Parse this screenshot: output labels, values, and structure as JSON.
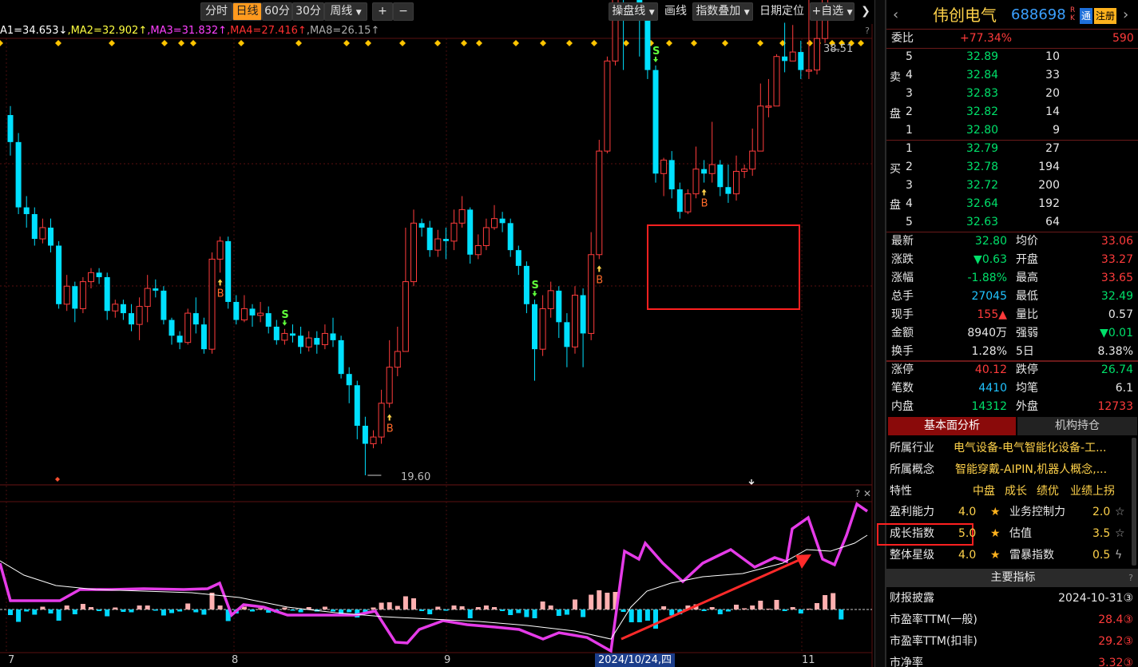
{
  "toolbar": {
    "period_tabs": [
      "分时",
      "日线",
      "60分",
      "30分",
      "周线"
    ],
    "active_period": "日线",
    "zoom_in": "+",
    "zoom_out": "−",
    "tools": [
      "操盘线",
      "画线",
      "指数叠加",
      "日期定位",
      "+自选"
    ],
    "collapse_icon": "double-chevron-right-icon"
  },
  "ma_legend": [
    {
      "text": "A1=34.653↓",
      "color": "#ffffff"
    },
    {
      "text": ",MA2=32.902↑",
      "color": "#ffff40"
    },
    {
      "text": ",MA3=31.832↑",
      "color": "#ff40ff"
    },
    {
      "text": ",MA4=27.416↑",
      "color": "#ff3030"
    },
    {
      "text": ",MA8=26.15↑",
      "color": "#aaaaaa"
    }
  ],
  "chart_data": {
    "type": "candlestick",
    "high_label": "38.51",
    "low_label": "19.60",
    "signal_buy": "B",
    "signal_sell": "S",
    "x_month_labels": [
      "7",
      "8",
      "9",
      "10",
      "11"
    ],
    "current_date": "2024/10/24,四",
    "candles": [
      [
        35.6,
        34.4,
        36.0,
        33.8
      ],
      [
        34.4,
        31.5,
        34.8,
        31.2
      ],
      [
        31.5,
        31.2,
        32.0,
        30.6
      ],
      [
        31.2,
        30.1,
        31.5,
        29.8
      ],
      [
        30.1,
        30.6,
        31.0,
        29.9
      ],
      [
        30.6,
        29.8,
        31.0,
        29.5
      ],
      [
        29.8,
        27.2,
        30.0,
        27.0
      ],
      [
        27.2,
        28.0,
        28.5,
        26.9
      ],
      [
        28.0,
        27.0,
        28.2,
        26.4
      ],
      [
        27.0,
        28.2,
        28.4,
        26.8
      ],
      [
        28.2,
        28.6,
        28.8,
        27.9
      ],
      [
        28.6,
        28.4,
        28.8,
        28.1
      ],
      [
        28.4,
        26.9,
        28.6,
        26.5
      ],
      [
        26.9,
        27.2,
        27.4,
        26.6
      ],
      [
        27.2,
        26.8,
        27.4,
        26.5
      ],
      [
        26.8,
        26.3,
        27.2,
        26.0
      ],
      [
        26.3,
        27.1,
        27.5,
        25.6
      ],
      [
        27.1,
        27.9,
        28.5,
        26.4
      ],
      [
        27.9,
        27.8,
        28.3,
        27.5
      ],
      [
        27.8,
        26.5,
        28.0,
        26.3
      ],
      [
        26.5,
        25.8,
        26.6,
        25.4
      ],
      [
        25.8,
        25.5,
        26.0,
        25.2
      ],
      [
        25.5,
        26.8,
        27.0,
        25.4
      ],
      [
        26.8,
        26.3,
        27.5,
        25.9
      ],
      [
        26.3,
        25.2,
        26.6,
        25.0
      ],
      [
        25.2,
        29.2,
        29.5,
        25.0
      ],
      [
        29.2,
        30.0,
        30.2,
        28.6
      ],
      [
        30.0,
        27.3,
        30.2,
        27.0
      ],
      [
        27.3,
        26.5,
        27.6,
        26.3
      ],
      [
        26.5,
        27.0,
        27.6,
        26.4
      ],
      [
        27.0,
        26.7,
        27.2,
        26.2
      ],
      [
        26.7,
        26.8,
        27.3,
        26.4
      ],
      [
        26.8,
        26.2,
        27.1,
        25.9
      ],
      [
        26.2,
        25.6,
        26.5,
        25.4
      ],
      [
        25.6,
        25.9,
        26.1,
        25.4
      ],
      [
        25.9,
        25.8,
        26.3,
        25.5
      ],
      [
        25.8,
        25.3,
        26.2,
        25.0
      ],
      [
        25.3,
        25.7,
        26.0,
        25.1
      ],
      [
        25.7,
        25.4,
        26.0,
        25.0
      ],
      [
        25.4,
        25.9,
        26.3,
        25.2
      ],
      [
        25.9,
        25.6,
        26.6,
        25.3
      ],
      [
        25.6,
        24.1,
        25.8,
        23.9
      ],
      [
        24.1,
        23.6,
        24.4,
        22.8
      ],
      [
        23.6,
        21.8,
        23.8,
        21.2
      ],
      [
        21.8,
        21.0,
        22.2,
        19.6
      ],
      [
        21.0,
        21.3,
        21.6,
        20.8
      ],
      [
        21.3,
        22.8,
        23.4,
        21.0
      ],
      [
        22.8,
        24.4,
        25.6,
        22.6
      ],
      [
        24.4,
        25.1,
        26.2,
        24.0
      ],
      [
        25.1,
        28.2,
        30.6,
        25.1
      ],
      [
        28.2,
        30.8,
        31.4,
        28.0
      ],
      [
        30.8,
        30.6,
        31.0,
        30.2
      ],
      [
        30.6,
        29.6,
        30.9,
        29.3
      ],
      [
        29.6,
        30.1,
        30.5,
        29.3
      ],
      [
        30.1,
        30.0,
        30.6,
        29.2
      ],
      [
        30.0,
        30.8,
        31.4,
        29.6
      ],
      [
        30.8,
        31.4,
        32.0,
        30.6
      ],
      [
        31.4,
        29.4,
        31.5,
        29.0
      ],
      [
        29.4,
        29.8,
        30.3,
        29.2
      ],
      [
        29.8,
        30.6,
        31.0,
        29.6
      ],
      [
        30.6,
        31.0,
        31.6,
        30.5
      ],
      [
        31.0,
        30.8,
        31.3,
        30.4
      ],
      [
        30.8,
        29.6,
        31.0,
        29.3
      ],
      [
        29.6,
        28.9,
        29.8,
        28.5
      ],
      [
        28.9,
        27.2,
        29.1,
        26.8
      ],
      [
        27.2,
        25.2,
        27.4,
        23.8
      ],
      [
        25.2,
        27.0,
        27.6,
        24.9
      ],
      [
        27.0,
        27.8,
        28.2,
        26.6
      ],
      [
        27.8,
        26.4,
        28.0,
        25.7
      ],
      [
        26.4,
        25.3,
        26.8,
        24.4
      ],
      [
        25.3,
        27.6,
        28.0,
        25.0
      ],
      [
        27.6,
        25.9,
        27.9,
        24.4
      ],
      [
        25.9,
        29.4,
        30.4,
        25.6
      ],
      [
        29.4,
        34.0,
        34.5,
        29.2
      ],
      [
        34.0,
        38.0,
        38.2,
        33.9
      ],
      [
        38.0,
        42.2,
        43.5,
        37.8
      ],
      [
        43.1,
        42.7,
        46.2,
        37.6
      ],
      [
        46.0,
        43.0,
        47.0,
        42.0
      ],
      [
        43.0,
        40.0,
        43.5,
        38.2
      ],
      [
        40.2,
        37.6,
        40.4,
        37.2
      ],
      [
        37.6,
        33.0,
        37.8,
        32.6
      ],
      [
        33.0,
        33.6,
        33.7,
        32.0
      ],
      [
        33.6,
        32.3,
        34.0,
        31.9
      ],
      [
        32.3,
        31.3,
        32.6,
        31.0
      ],
      [
        31.3,
        32.1,
        32.3,
        31.2
      ],
      [
        32.1,
        33.2,
        34.2,
        31.9
      ],
      [
        33.2,
        33.0,
        33.6,
        32.6
      ],
      [
        33.0,
        33.4,
        35.3,
        32.6
      ],
      [
        33.4,
        32.4,
        33.6,
        32.0
      ],
      [
        32.4,
        32.1,
        33.4,
        31.7
      ],
      [
        32.1,
        33.1,
        33.8,
        31.8
      ],
      [
        33.1,
        33.2,
        33.4,
        32.8
      ],
      [
        33.2,
        34.0,
        35.0,
        32.9
      ],
      [
        34.0,
        36.0,
        37.0,
        34.0
      ],
      [
        36.0,
        36.0,
        37.2,
        35.5
      ],
      [
        36.0,
        38.2,
        38.3,
        36.5
      ],
      [
        38.2,
        38.0,
        39.7,
        37.5
      ],
      [
        38.0,
        38.4,
        39.6,
        38.1
      ],
      [
        38.4,
        37.6,
        38.9,
        37.2
      ],
      [
        37.6,
        37.6,
        40.8,
        37.2
      ],
      [
        37.6,
        39.0,
        40.3,
        37.4
      ],
      [
        39.0,
        42.4,
        42.8,
        38.8
      ],
      [
        42.4,
        46.3,
        46.5,
        42.0
      ],
      [
        46.3,
        44.0,
        48.5,
        43.8
      ]
    ]
  },
  "quote": {
    "name": "伟创电气",
    "code": "688698",
    "badge_rk": "R K",
    "badge_tong": "通",
    "badge_zc": "注册",
    "weibi_label": "委比",
    "weibi_value": "+77.34%",
    "weibi_diff": "590",
    "sell_label": [
      "卖",
      "盘"
    ],
    "buy_label": [
      "买",
      "盘"
    ],
    "asks": [
      {
        "lvl": "5",
        "price": "32.89",
        "vol": "10"
      },
      {
        "lvl": "4",
        "price": "32.84",
        "vol": "33"
      },
      {
        "lvl": "3",
        "price": "32.83",
        "vol": "20"
      },
      {
        "lvl": "2",
        "price": "32.82",
        "vol": "14"
      },
      {
        "lvl": "1",
        "price": "32.80",
        "vol": "9"
      }
    ],
    "bids": [
      {
        "lvl": "1",
        "price": "32.79",
        "vol": "27"
      },
      {
        "lvl": "2",
        "price": "32.78",
        "vol": "194"
      },
      {
        "lvl": "3",
        "price": "32.72",
        "vol": "200"
      },
      {
        "lvl": "4",
        "price": "32.64",
        "vol": "192"
      },
      {
        "lvl": "5",
        "price": "32.63",
        "vol": "64"
      }
    ],
    "stats": [
      {
        "l1": "最新",
        "v1": "32.80",
        "c1": "grn",
        "l2": "均价",
        "v2": "33.06",
        "c2": "red"
      },
      {
        "l1": "涨跌",
        "v1": "▼0.63",
        "c1": "grn",
        "l2": "开盘",
        "v2": "33.27",
        "c2": "red"
      },
      {
        "l1": "涨幅",
        "v1": "-1.88%",
        "c1": "grn",
        "l2": "最高",
        "v2": "33.65",
        "c2": "red"
      },
      {
        "l1": "总手",
        "v1": "27045",
        "c1": "cy",
        "l2": "最低",
        "v2": "32.49",
        "c2": "grn"
      },
      {
        "l1": "现手",
        "v1": "155▲",
        "c1": "red",
        "l2": "量比",
        "v2": "0.57",
        "c2": "wht"
      },
      {
        "l1": "金额",
        "v1": "8940万",
        "c1": "wht",
        "l2": "强弱",
        "v2": "▼0.01",
        "c2": "grn"
      },
      {
        "l1": "换手",
        "v1": "1.28%",
        "c1": "wht",
        "l2": "5日",
        "v2": "8.38%",
        "c2": "wht"
      },
      {
        "l1": "涨停",
        "v1": "40.12",
        "c1": "red",
        "l2": "跌停",
        "v2": "26.74",
        "c2": "grn"
      },
      {
        "l1": "笔数",
        "v1": "4410",
        "c1": "cy",
        "l2": "均笔",
        "v2": "6.1",
        "c2": "wht"
      },
      {
        "l1": "内盘",
        "v1": "14312",
        "c1": "grn",
        "l2": "外盘",
        "v2": "12733",
        "c2": "red"
      }
    ],
    "tabs": [
      "基本面分析",
      "机构持仓"
    ],
    "industry_label": "所属行业",
    "industry_value": "电气设备-电气智能化设备-工...",
    "concept_label": "所属概念",
    "concept_value": "智能穿戴-AIPIN,机器人概念,...",
    "feature_label": "特性",
    "features": [
      "中盘",
      "成长",
      "绩优",
      "业绩上拐"
    ],
    "ratings": [
      {
        "l1": "盈利能力",
        "v1": "4.0",
        "l2": "业务控制力",
        "v2": "2.0",
        "s2": "hollow"
      },
      {
        "l1": "成长指数",
        "v1": "5.0",
        "l2": "估值",
        "v2": "3.5",
        "s2": "hollow"
      },
      {
        "l1": "整体星级",
        "v1": "4.0",
        "l2": "雷暴指数",
        "v2": "0.5",
        "s2": "lightning"
      }
    ],
    "main_ind_title": "主要指标",
    "indicators": [
      {
        "label": "财报披露",
        "value": "2024-10-31③"
      },
      {
        "label": "市盈率TTM(一般)",
        "value": "28.4③"
      },
      {
        "label": "市盈率TTM(扣非)",
        "value": "29.2③"
      },
      {
        "label": "市净率",
        "value": "3.32③"
      }
    ]
  },
  "colors": {
    "up": "#ff3c3c",
    "down": "#00e0ff",
    "accent": "#ff9a1e",
    "purple": "#e53be8",
    "box": "#ff2020"
  }
}
